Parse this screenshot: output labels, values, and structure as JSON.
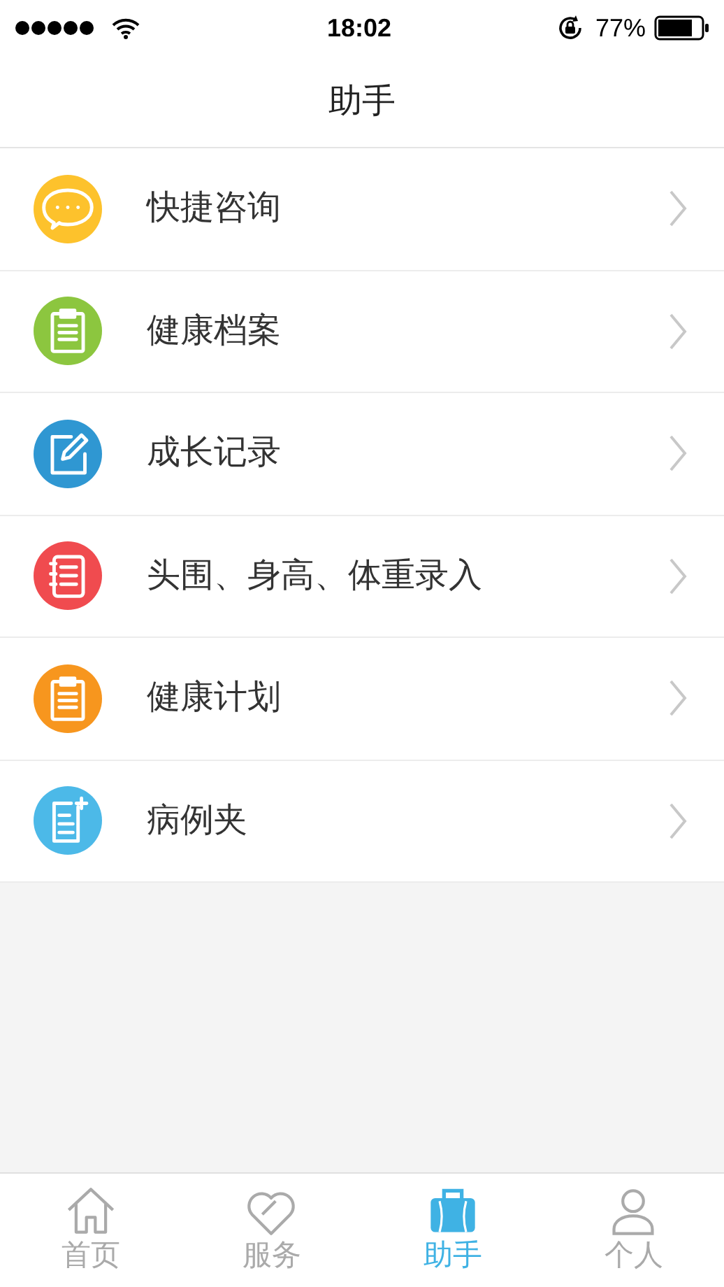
{
  "status_bar": {
    "time": "18:02",
    "battery": "77%"
  },
  "header": {
    "title": "助手"
  },
  "menu": [
    {
      "label": "快捷咨询",
      "kind": "chat",
      "color": "#fdc22c"
    },
    {
      "label": "健康档案",
      "kind": "clipboard",
      "color": "#8cc63f"
    },
    {
      "label": "成长记录",
      "kind": "edit",
      "color": "#2f97d2"
    },
    {
      "label": "头围、身高、体重录入",
      "kind": "notebook",
      "color": "#f04b4f"
    },
    {
      "label": "健康计划",
      "kind": "clipboard",
      "color": "#f7961e"
    },
    {
      "label": "病例夹",
      "kind": "document",
      "color": "#4cb9e8"
    }
  ],
  "tab_bar": [
    {
      "label": "首页",
      "kind": "home",
      "selected": false
    },
    {
      "label": "服务",
      "kind": "heart",
      "selected": false
    },
    {
      "label": "助手",
      "kind": "bag",
      "selected": true
    },
    {
      "label": "个人",
      "kind": "person",
      "selected": false
    }
  ]
}
